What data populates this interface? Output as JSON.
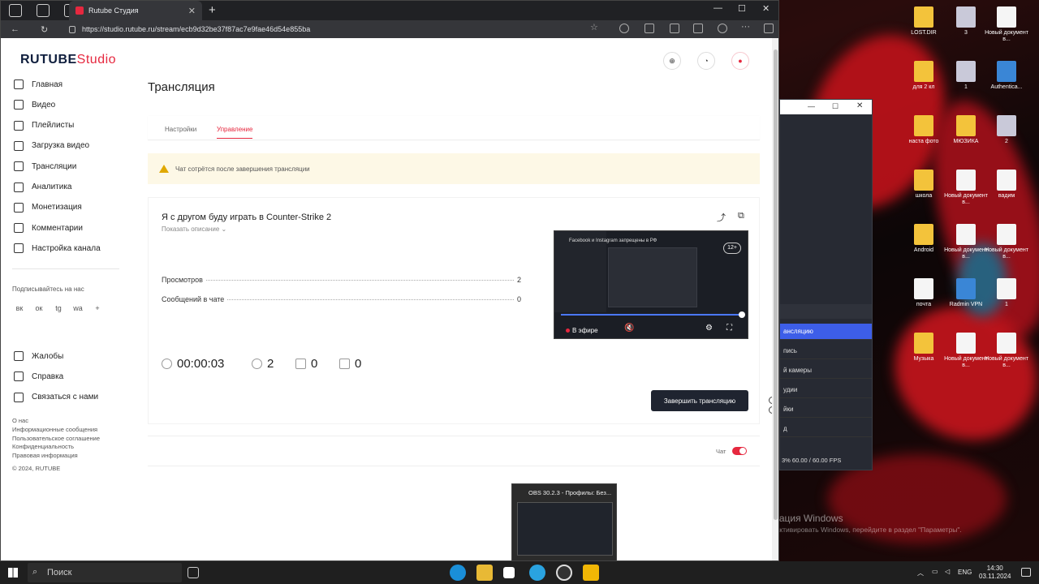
{
  "browser": {
    "tab_title": "Rutube Студия",
    "url": "https://studio.rutube.ru/stream/ecb9d32be37f87ac7e9fae46d54e855ba"
  },
  "logo": {
    "text": "RUTUBE",
    "studio": "Studio"
  },
  "sidebar": {
    "items": [
      {
        "label": "Главная",
        "icon": "home-icon"
      },
      {
        "label": "Видео",
        "icon": "video-icon"
      },
      {
        "label": "Плейлисты",
        "icon": "playlist-icon"
      },
      {
        "label": "Загрузка видео",
        "icon": "upload-icon"
      },
      {
        "label": "Трансляции",
        "icon": "broadcast-icon"
      },
      {
        "label": "Аналитика",
        "icon": "analytics-icon"
      },
      {
        "label": "Монетизация",
        "icon": "money-icon"
      },
      {
        "label": "Комментарии",
        "icon": "comments-icon"
      },
      {
        "label": "Настройка канала",
        "icon": "settings-icon"
      }
    ],
    "subscribe_label": "Подписывайтесь на нас",
    "social": [
      "вк",
      "ок",
      "tg",
      "wa",
      "+"
    ],
    "support": [
      {
        "label": "Жалобы"
      },
      {
        "label": "Справка"
      },
      {
        "label": "Связаться с нами"
      }
    ],
    "footer_links": [
      "О нас",
      "Информационные сообщения",
      "Пользовательское соглашение",
      "Конфиденциальность",
      "Правовая информация"
    ],
    "copyright": "© 2024, RUTUBE"
  },
  "page": {
    "title": "Трансляция",
    "tabs": [
      "Настройки",
      "Управление"
    ],
    "alert": "Чат сотрётся после завершения трансляции"
  },
  "stream": {
    "title": "Я с другом буду играть в Counter-Strike 2",
    "show_description": "Показать описание",
    "views_label": "Просмотров",
    "views_value": "2",
    "chat_label": "Сообщений в чате",
    "chat_value": "0",
    "duration": "00:00:03",
    "viewers": "2",
    "likes": "0",
    "dislikes": "0",
    "end_button": "Завершить трансляцию",
    "video_banner": "Facebook и Instagram запрещены в РФ",
    "age": "12+",
    "live_label": "В эфире",
    "progress": 1.0
  },
  "chat": {
    "label": "Чат",
    "enabled": true
  },
  "obs": {
    "items": [
      "ансляцию",
      "пись",
      "й камеры",
      "удии",
      "йки",
      "д"
    ],
    "stats": "3%    60.00 / 60.00 FPS"
  },
  "desktop_icons": [
    "LOST.DIR",
    "3",
    "Новый документ в...",
    "для 2 кл",
    "1",
    "Authentica...",
    "наста фото",
    "МЮЗИКА",
    "2",
    "школа",
    "Новый документ в...",
    "вадим",
    "Android",
    "Новый документ в...",
    "Новый документ в...",
    "почта",
    "Radmin VPN",
    "1",
    "Музыка",
    "Новый документ в...",
    "Новый документ в..."
  ],
  "watermark": {
    "title": "Активация Windows",
    "text": "Чтобы активировать Windows, перейдите в раздел \"Параметры\"."
  },
  "taskbar": {
    "search": "Поиск",
    "thumb_title": "OBS 30.2.3 - Профилы: Без...",
    "tray_lang": "ENG",
    "time": "14:30",
    "date": "03.11.2024"
  }
}
